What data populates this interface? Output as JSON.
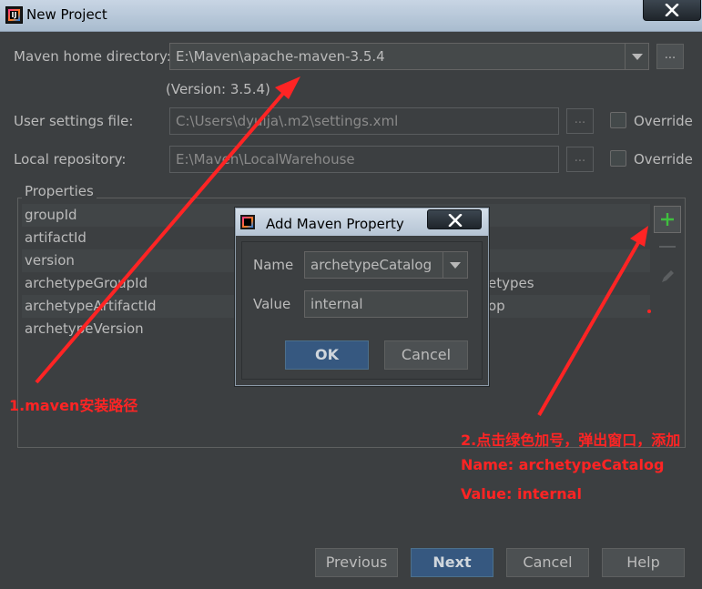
{
  "window": {
    "title": "New Project"
  },
  "maven_home": {
    "label": "Maven home directory:",
    "value": "E:\\Maven\\apache-maven-3.5.4",
    "version": "(Version: 3.5.4)",
    "browse": "..."
  },
  "user_settings": {
    "label": "User settings file:",
    "value": "C:\\Users\\dyuija\\.m2\\settings.xml",
    "browse": "...",
    "override": "Override"
  },
  "local_repo": {
    "label": "Local repository:",
    "value": "E:\\Maven\\LocalWarehouse",
    "browse": "...",
    "override": "Override"
  },
  "properties": {
    "label": "Properties",
    "rows": [
      {
        "key": "groupId",
        "value": ""
      },
      {
        "key": "artifactId",
        "value": ""
      },
      {
        "key": "version",
        "value": ""
      },
      {
        "key": "archetypeGroupId",
        "value": "etypes"
      },
      {
        "key": "archetypeArtifactId",
        "value": "op"
      },
      {
        "key": "archetypeVersion",
        "value": ""
      }
    ]
  },
  "dialog": {
    "title": "Add Maven Property",
    "name_label": "Name",
    "name_value": "archetypeCatalog",
    "value_label": "Value",
    "value_value": "internal",
    "ok": "OK",
    "cancel": "Cancel"
  },
  "footer": {
    "previous": "Previous",
    "next": "Next",
    "cancel": "Cancel",
    "help": "Help"
  },
  "annotations": {
    "step1": "1.maven安装路径",
    "step2": "2.点击绿色加号，弹出窗口，添加",
    "name_line": "Name: archetypeCatalog",
    "value_line": "Value: internal"
  },
  "colors": {
    "annotation": "#ff2424",
    "add_icon": "#3fbf3f",
    "primary_button": "#365880"
  },
  "icons": {
    "add": "plus-icon",
    "remove": "minus-icon",
    "edit": "pencil-icon",
    "close": "close-icon",
    "dropdown": "chevron-down-icon"
  }
}
